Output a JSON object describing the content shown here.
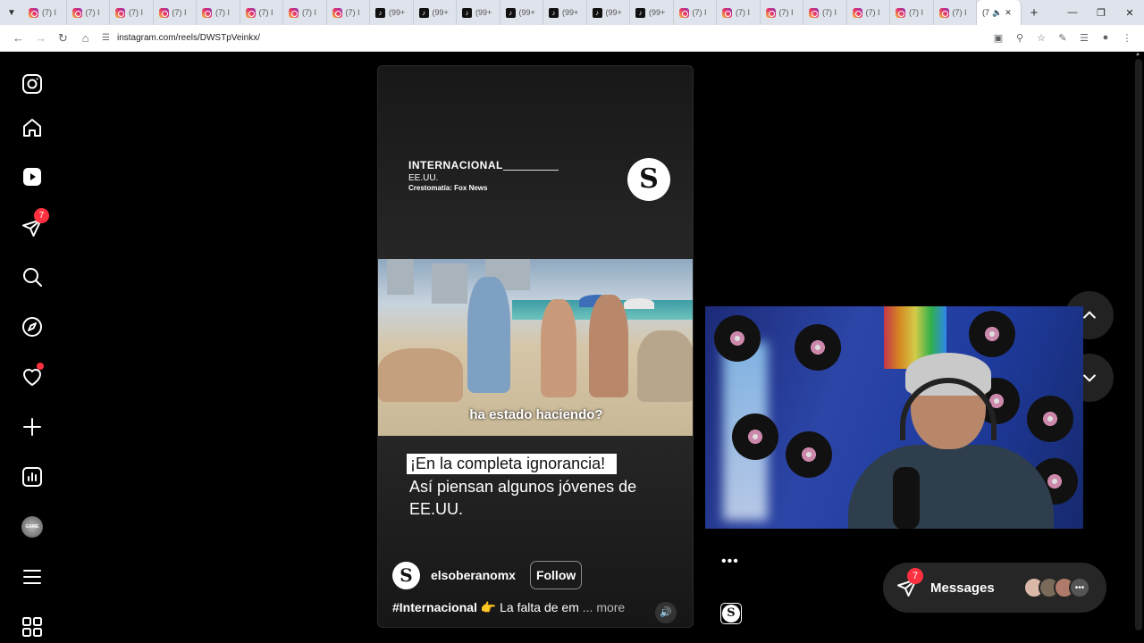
{
  "browser": {
    "tabs": [
      {
        "icon": "instagram",
        "label": "(7) I"
      },
      {
        "icon": "instagram",
        "label": "(7) I"
      },
      {
        "icon": "instagram",
        "label": "(7) I"
      },
      {
        "icon": "instagram",
        "label": "(7) I"
      },
      {
        "icon": "instagram",
        "label": "(7) I"
      },
      {
        "icon": "instagram",
        "label": "(7) I"
      },
      {
        "icon": "instagram",
        "label": "(7) I"
      },
      {
        "icon": "instagram",
        "label": "(7) I"
      },
      {
        "icon": "tiktok",
        "label": "(99+"
      },
      {
        "icon": "tiktok",
        "label": "(99+"
      },
      {
        "icon": "tiktok",
        "label": "(99+"
      },
      {
        "icon": "tiktok",
        "label": "(99+"
      },
      {
        "icon": "tiktok",
        "label": "(99+"
      },
      {
        "icon": "tiktok",
        "label": "(99+"
      },
      {
        "icon": "tiktok",
        "label": "(99+"
      },
      {
        "icon": "instagram",
        "label": "(7) I"
      },
      {
        "icon": "instagram",
        "label": "(7) I"
      },
      {
        "icon": "instagram",
        "label": "(7) I"
      },
      {
        "icon": "instagram",
        "label": "(7) I"
      },
      {
        "icon": "instagram",
        "label": "(7) I"
      },
      {
        "icon": "instagram",
        "label": "(7) I"
      },
      {
        "icon": "instagram",
        "label": "(7) I"
      }
    ],
    "active_tab_label": "(7",
    "url": "instagram.com/reels/DWSTpVeinkx/"
  },
  "sidebar": {
    "notifications_badge": "7",
    "items": [
      "instagram-logo",
      "home",
      "reels",
      "messages",
      "search",
      "explore",
      "notifications",
      "create",
      "dashboard",
      "profile",
      "more",
      "also-from-meta"
    ]
  },
  "reel": {
    "category": "INTERNACIONAL",
    "country": "EE.UU.",
    "source": "Crestomatía: Fox News",
    "logo_letter": "S",
    "subtitle": "ha estado haciendo?",
    "caption_highlight": "¡En la completa ignorancia!",
    "caption_rest": "Así piensan algunos jóvenes de EE.UU.",
    "account_name": "elsoberanomx",
    "follow_label": "Follow",
    "desc_hashtag": "#Internacional",
    "desc_emoji": "👉",
    "desc_text": " La falta de em",
    "desc_more": " ... more",
    "more_actions": "•••"
  },
  "messages": {
    "label": "Messages",
    "badge": "7",
    "avatars_more": "•••"
  },
  "colors": {
    "badge_red": "#ff3040",
    "page_bg": "#000000",
    "reel_bg": "#1c1c1c"
  }
}
